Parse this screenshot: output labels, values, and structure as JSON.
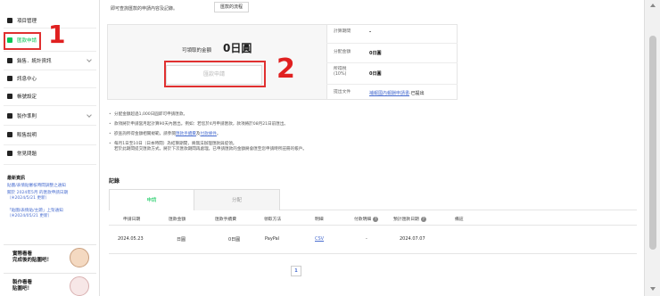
{
  "sidebar": {
    "items": [
      {
        "label": "項目管理",
        "icon": "gear-icon"
      },
      {
        "label": "匯款申請",
        "icon": "wallet-icon"
      },
      {
        "label": "銷售．統計資訊",
        "icon": "chart-icon"
      },
      {
        "label": "訊息中心",
        "icon": "mail-icon"
      },
      {
        "label": "帳號設定",
        "icon": "user-icon"
      },
      {
        "label": "製作準則",
        "icon": "document-icon"
      },
      {
        "label": "販售說明",
        "icon": "book-icon"
      },
      {
        "label": "常見問題",
        "icon": "help-icon"
      }
    ],
    "notice_title": "最新資訊",
    "notices": [
      "貼圖/表情貼審核時間調整之通知",
      "關於 2024年5月 的匯款申請日期（※2024/5/21 更新）",
      "「貼圖/表情貼/主題」上架通知（※2024/05/21 更新）"
    ],
    "promos": [
      {
        "text": "實際看看\n完成後的貼圖吧！"
      },
      {
        "text": "製作看看\n貼圖吧！"
      }
    ]
  },
  "annotations": {
    "num1": "1",
    "num2": "2"
  },
  "top": {
    "note": "即可查詢匯款的申請內容及記錄。",
    "process_button": "匯款的流程"
  },
  "payout": {
    "amount_label": "可領取的金額",
    "amount_value": "0日圓",
    "request_button": "匯款申請"
  },
  "info": {
    "rows": [
      {
        "label": "計算期間",
        "value": "-"
      },
      {
        "label": "分配金額",
        "value": "0日圓"
      },
      {
        "label": "所得稅\n(10%)",
        "value": "0日圓"
      },
      {
        "label": "提出文件",
        "link": "補報國內報酬申請書",
        "suffix": "·已提出"
      }
    ]
  },
  "rules": [
    {
      "text": "分配金額超過1,000日圓即可申請匯款。"
    },
    {
      "text": "款項將於申請當月起計算90天內匯出。例如：若您於4月申請匯款，款項將於08月21日前匯出。"
    },
    {
      "pre": "欲查詢所得金額相關規範，請參閱",
      "link1": "匯款手續費",
      "mid": "及",
      "link2": "付款條件",
      "post": "。"
    },
    {
      "text": "每月1日至10日（日本時間）為結算期間，將無法辦理匯款與提領。\n若於此期間提交匯款方式，將於下次匯款期間再處理。已申請匯款的金額將會匯至您申請時所註冊的帳戶。"
    }
  ],
  "records": {
    "title": "記錄",
    "tabs": [
      "申請",
      "分配"
    ],
    "headers": [
      "申請日期",
      "匯款金額",
      "匯款手續費",
      "領取方法",
      "明細",
      "付款明細",
      "預計匯款日期",
      "備註"
    ],
    "rows": [
      {
        "date": "2024.05.23",
        "amount": "日圓",
        "fee": "0日圓",
        "method": "PayPal",
        "detail": "CSV",
        "payment": "-",
        "expected": "2024.07.07",
        "note": ""
      }
    ],
    "page": "1"
  }
}
